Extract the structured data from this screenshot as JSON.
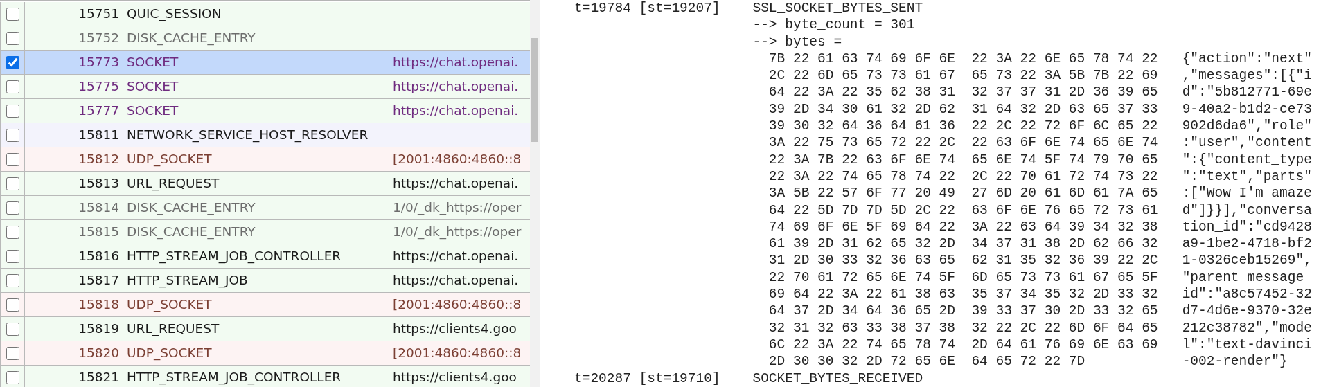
{
  "events_table": {
    "rows": [
      {
        "checked": false,
        "selected": false,
        "id": "15751",
        "type": "QUIC_SESSION",
        "color": "#1a1a1a",
        "kind": "normal"
      },
      {
        "checked": false,
        "selected": false,
        "id": "15752",
        "type": "DISK_CACHE_ENTRY",
        "color": "#6d6d6d",
        "kind": "normal"
      },
      {
        "checked": true,
        "selected": true,
        "id": "15773",
        "type": "SOCKET",
        "source": "https://chat.openai.",
        "color": "#6f2b7f",
        "kind": "normal"
      },
      {
        "checked": false,
        "selected": false,
        "id": "15775",
        "type": "SOCKET",
        "source": "https://chat.openai.",
        "color": "#6f2b7f",
        "kind": "normal"
      },
      {
        "checked": false,
        "selected": false,
        "id": "15777",
        "type": "SOCKET",
        "source": "https://chat.openai.",
        "color": "#6f2b7f",
        "kind": "normal"
      },
      {
        "checked": false,
        "selected": false,
        "id": "15811",
        "type": "NETWORK_SERVICE_HOST_RESOLVER",
        "color": "#1a1a1a",
        "kind": "resolver"
      },
      {
        "checked": false,
        "selected": false,
        "id": "15812",
        "type": "UDP_SOCKET",
        "source": "[2001:4860:4860::8",
        "color": "#7b3f33",
        "kind": "udp"
      },
      {
        "checked": false,
        "selected": false,
        "id": "15813",
        "type": "URL_REQUEST",
        "source": "https://chat.openai.",
        "color": "#1a1a1a",
        "kind": "normal"
      },
      {
        "checked": false,
        "selected": false,
        "id": "15814",
        "type": "DISK_CACHE_ENTRY",
        "source": "1/0/_dk_https://oper",
        "color": "#6d6d6d",
        "kind": "normal"
      },
      {
        "checked": false,
        "selected": false,
        "id": "15815",
        "type": "DISK_CACHE_ENTRY",
        "source": "1/0/_dk_https://oper",
        "color": "#6d6d6d",
        "kind": "normal"
      },
      {
        "checked": false,
        "selected": false,
        "id": "15816",
        "type": "HTTP_STREAM_JOB_CONTROLLER",
        "source": "https://chat.openai.",
        "color": "#1a1a1a",
        "kind": "normal"
      },
      {
        "checked": false,
        "selected": false,
        "id": "15817",
        "type": "HTTP_STREAM_JOB",
        "source": "https://chat.openai.",
        "color": "#1a1a1a",
        "kind": "normal"
      },
      {
        "checked": false,
        "selected": false,
        "id": "15818",
        "type": "UDP_SOCKET",
        "source": "[2001:4860:4860::8",
        "color": "#7b3f33",
        "kind": "udp"
      },
      {
        "checked": false,
        "selected": false,
        "id": "15819",
        "type": "URL_REQUEST",
        "source": "https://clients4.goo",
        "color": "#1a1a1a",
        "kind": "normal"
      },
      {
        "checked": false,
        "selected": false,
        "id": "15820",
        "type": "UDP_SOCKET",
        "source": "[2001:4860:4860::8",
        "color": "#7b3f33",
        "kind": "udp"
      },
      {
        "checked": false,
        "selected": false,
        "id": "15821",
        "type": "HTTP_STREAM_JOB_CONTROLLER",
        "source": "https://clients4.goo",
        "color": "#1a1a1a",
        "kind": "normal"
      }
    ]
  },
  "log": {
    "entries": [
      {
        "kind": "event",
        "time": "t=19784 [st=19207]",
        "event": "SSL_SOCKET_BYTES_SENT"
      },
      {
        "kind": "param",
        "text": "--> byte_count = 301"
      },
      {
        "kind": "param",
        "text": "--> bytes ="
      },
      {
        "kind": "hex",
        "hex": "7B 22 61 63 74 69 6F 6E  22 3A 22 6E 65 78 74 22",
        "ascii": "{\"action\":\"next\""
      },
      {
        "kind": "hex",
        "hex": "2C 22 6D 65 73 73 61 67  65 73 22 3A 5B 7B 22 69",
        "ascii": ",\"messages\":[{\"i"
      },
      {
        "kind": "hex",
        "hex": "64 22 3A 22 35 62 38 31  32 37 37 31 2D 36 39 65",
        "ascii": "d\":\"5b812771-69e"
      },
      {
        "kind": "hex",
        "hex": "39 2D 34 30 61 32 2D 62  31 64 32 2D 63 65 37 33",
        "ascii": "9-40a2-b1d2-ce73"
      },
      {
        "kind": "hex",
        "hex": "39 30 32 64 36 64 61 36  22 2C 22 72 6F 6C 65 22",
        "ascii": "902d6da6\",\"role\""
      },
      {
        "kind": "hex",
        "hex": "3A 22 75 73 65 72 22 2C  22 63 6F 6E 74 65 6E 74",
        "ascii": ":\"user\",\"content"
      },
      {
        "kind": "hex",
        "hex": "22 3A 7B 22 63 6F 6E 74  65 6E 74 5F 74 79 70 65",
        "ascii": "\":{\"content_type"
      },
      {
        "kind": "hex",
        "hex": "22 3A 22 74 65 78 74 22  2C 22 70 61 72 74 73 22",
        "ascii": "\":\"text\",\"parts\""
      },
      {
        "kind": "hex",
        "hex": "3A 5B 22 57 6F 77 20 49  27 6D 20 61 6D 61 7A 65",
        "ascii": ":[\"Wow I'm amaze"
      },
      {
        "kind": "hex",
        "hex": "64 22 5D 7D 7D 5D 2C 22  63 6F 6E 76 65 72 73 61",
        "ascii": "d\"]}}],\"conversa"
      },
      {
        "kind": "hex",
        "hex": "74 69 6F 6E 5F 69 64 22  3A 22 63 64 39 34 32 38",
        "ascii": "tion_id\":\"cd9428"
      },
      {
        "kind": "hex",
        "hex": "61 39 2D 31 62 65 32 2D  34 37 31 38 2D 62 66 32",
        "ascii": "a9-1be2-4718-bf2"
      },
      {
        "kind": "hex",
        "hex": "31 2D 30 33 32 36 63 65  62 31 35 32 36 39 22 2C",
        "ascii": "1-0326ceb15269\","
      },
      {
        "kind": "hex",
        "hex": "22 70 61 72 65 6E 74 5F  6D 65 73 73 61 67 65 5F",
        "ascii": "\"parent_message_"
      },
      {
        "kind": "hex",
        "hex": "69 64 22 3A 22 61 38 63  35 37 34 35 32 2D 33 32",
        "ascii": "id\":\"a8c57452-32"
      },
      {
        "kind": "hex",
        "hex": "64 37 2D 34 64 36 65 2D  39 33 37 30 2D 33 32 65",
        "ascii": "d7-4d6e-9370-32e"
      },
      {
        "kind": "hex",
        "hex": "32 31 32 63 33 38 37 38  32 22 2C 22 6D 6F 64 65",
        "ascii": "212c38782\",\"mode"
      },
      {
        "kind": "hex",
        "hex": "6C 22 3A 22 74 65 78 74  2D 64 61 76 69 6E 63 69",
        "ascii": "l\":\"text-davinci"
      },
      {
        "kind": "hex",
        "hex": "2D 30 30 32 2D 72 65 6E  64 65 72 22 7D",
        "ascii": "-002-render\"}"
      },
      {
        "kind": "event",
        "time": "t=20287 [st=19710]",
        "event": "SOCKET_BYTES_RECEIVED"
      }
    ]
  }
}
